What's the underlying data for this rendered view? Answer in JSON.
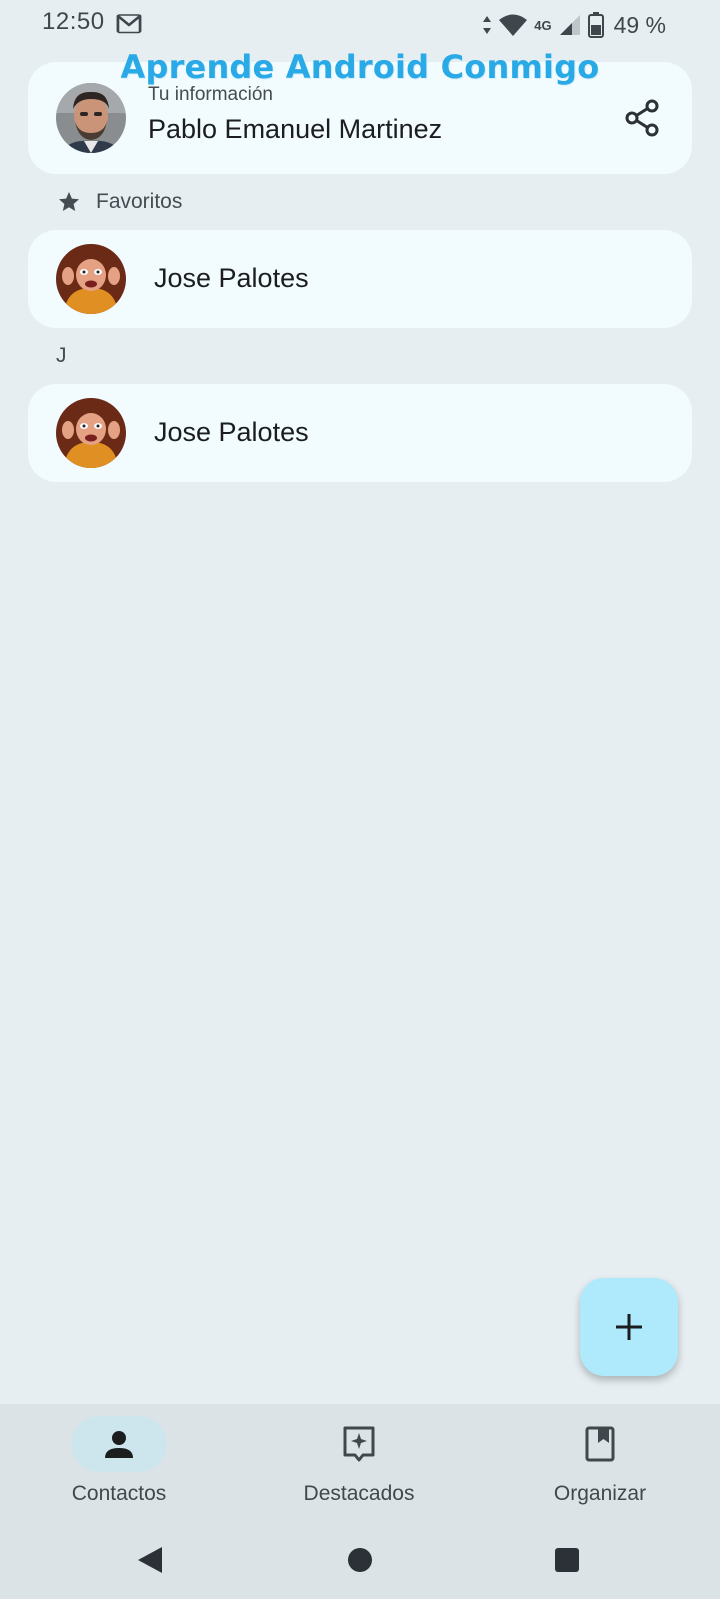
{
  "status_bar": {
    "time": "12:50",
    "network": "4G",
    "battery": "49 %",
    "icons": [
      "gmail-icon",
      "data-arrows-icon",
      "wifi-icon",
      "cell-signal-icon",
      "battery-icon"
    ]
  },
  "watermark": "Aprende Android Conmigo",
  "profile": {
    "subtitle": "Tu información",
    "name": "Pablo Emanuel Martinez",
    "share_icon": "share-icon"
  },
  "favorites": {
    "header": "Favoritos",
    "icon": "star-icon",
    "contacts": [
      {
        "name": "Jose Palotes"
      }
    ]
  },
  "sections": [
    {
      "letter": "J",
      "contacts": [
        {
          "name": "Jose Palotes"
        }
      ]
    }
  ],
  "fab": {
    "icon": "add-icon"
  },
  "bottom_nav": {
    "items": [
      {
        "label": "Contactos",
        "icon": "person-icon",
        "active": true
      },
      {
        "label": "Destacados",
        "icon": "highlights-icon",
        "active": false
      },
      {
        "label": "Organizar",
        "icon": "bookmark-icon",
        "active": false
      }
    ]
  },
  "colors": {
    "background": "#e6eef2",
    "card": "#f2fbfe",
    "fab": "#aeeafb",
    "nav_bar": "#dce3e7",
    "active_pill": "#cde6ee",
    "watermark": "#29a9e6"
  }
}
